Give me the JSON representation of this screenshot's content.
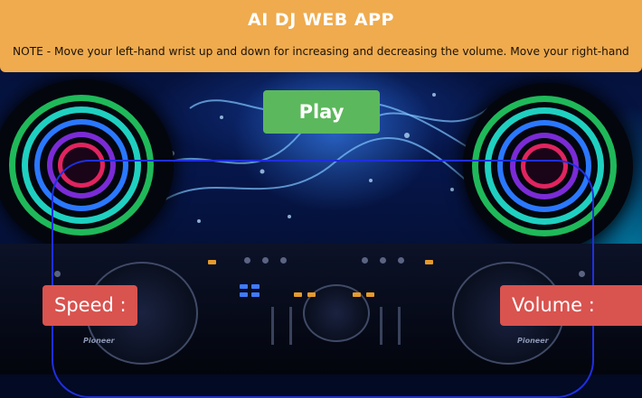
{
  "header": {
    "title": "AI DJ WEB APP",
    "note": "NOTE - Move your left-hand wrist up and down for increasing and decreasing the volume. Move your right-hand"
  },
  "controls": {
    "play_label": "Play",
    "speed_label": "Speed :",
    "volume_label": "Volume :"
  },
  "decks": {
    "brand_left": "Pioneer",
    "brand_right": "Pioneer"
  },
  "colors": {
    "header_bg": "#efab4e",
    "play_bg": "#5cb85c",
    "label_bg": "#d9534f",
    "frame_border": "#1f2fe0"
  },
  "icons": [
    "dj-background-image",
    "speaker-left-icon",
    "speaker-right-icon"
  ]
}
